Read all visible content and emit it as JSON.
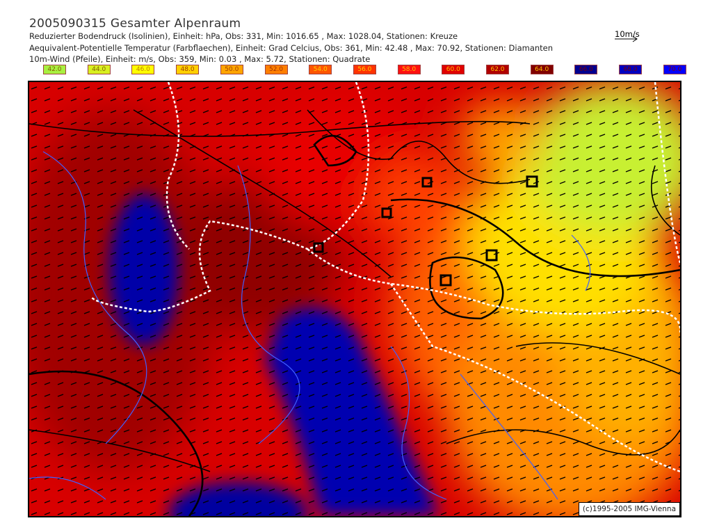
{
  "header": {
    "title": "2005090315 Gesamter Alpenraum",
    "line1": "Reduzierter Bodendruck (Isolinien), Einheit: hPa, Obs:  331, Min: 1016.65 , Max: 1028.04, Stationen: Kreuze",
    "line2": "Aequivalent-Potentielle Temperatur (Farbflaechen), Einheit: Grad Celcius, Obs:  361, Min:  42.48 , Max:  70.92, Stationen: Diamanten",
    "line3": "10m-Wind (Pfeile), Einheit: m/s, Obs:  359, Min:   0.03 , Max:   5.72, Stationen: Quadrate",
    "wind_scale": "10m/s"
  },
  "legend": [
    {
      "label": "42.0",
      "color": "#a8f040",
      "text": "#806000"
    },
    {
      "label": "44.0",
      "color": "#d8f020",
      "text": "#806000"
    },
    {
      "label": "46.0",
      "color": "#ffff00",
      "text": "#c08000"
    },
    {
      "label": "48.0",
      "color": "#ffd000",
      "text": "#a04000"
    },
    {
      "label": "50.0",
      "color": "#ffa500",
      "text": "#a04000"
    },
    {
      "label": "52.0",
      "color": "#ff7f00",
      "text": "#a03000"
    },
    {
      "label": "54.0",
      "color": "#ff5500",
      "text": "#ffd000"
    },
    {
      "label": "56.0",
      "color": "#ff3300",
      "text": "#ffd000"
    },
    {
      "label": "58.0",
      "color": "#ff1010",
      "text": "#ffc000"
    },
    {
      "label": "60.0",
      "color": "#e00000",
      "text": "#ffc000"
    },
    {
      "label": "62.0",
      "color": "#b00000",
      "text": "#ffc000"
    },
    {
      "label": "64.0",
      "color": "#800000",
      "text": "#ffc000"
    },
    {
      "label": "66.0",
      "color": "#000090",
      "text": "#800000"
    },
    {
      "label": "68.0",
      "color": "#0000c0",
      "text": "#800000"
    },
    {
      "label": "70.0",
      "color": "#0000ff",
      "text": "#800000"
    }
  ],
  "copyright": "(c)1995-2005 IMG-Vienna"
}
